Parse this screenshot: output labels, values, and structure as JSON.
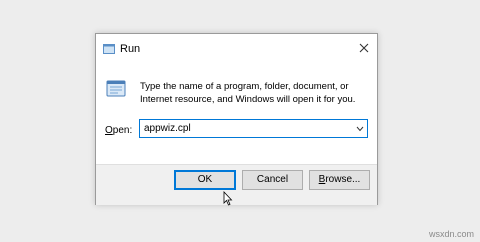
{
  "window": {
    "title": "Run",
    "close_icon": "close-icon"
  },
  "content": {
    "description": "Type the name of a program, folder, document, or Internet resource, and Windows will open it for you.",
    "open_label_prefix": "O",
    "open_label_suffix": "pen:",
    "open_value": "appwiz.cpl"
  },
  "buttons": {
    "ok": "OK",
    "cancel": "Cancel",
    "browse_prefix": "B",
    "browse_suffix": "rowse..."
  },
  "watermark": "wsxdn.com",
  "colors": {
    "accent": "#0078d7",
    "button_bg": "#e1e1e1",
    "footer_bg": "#f0f0f0",
    "page_bg": "#ededed"
  }
}
